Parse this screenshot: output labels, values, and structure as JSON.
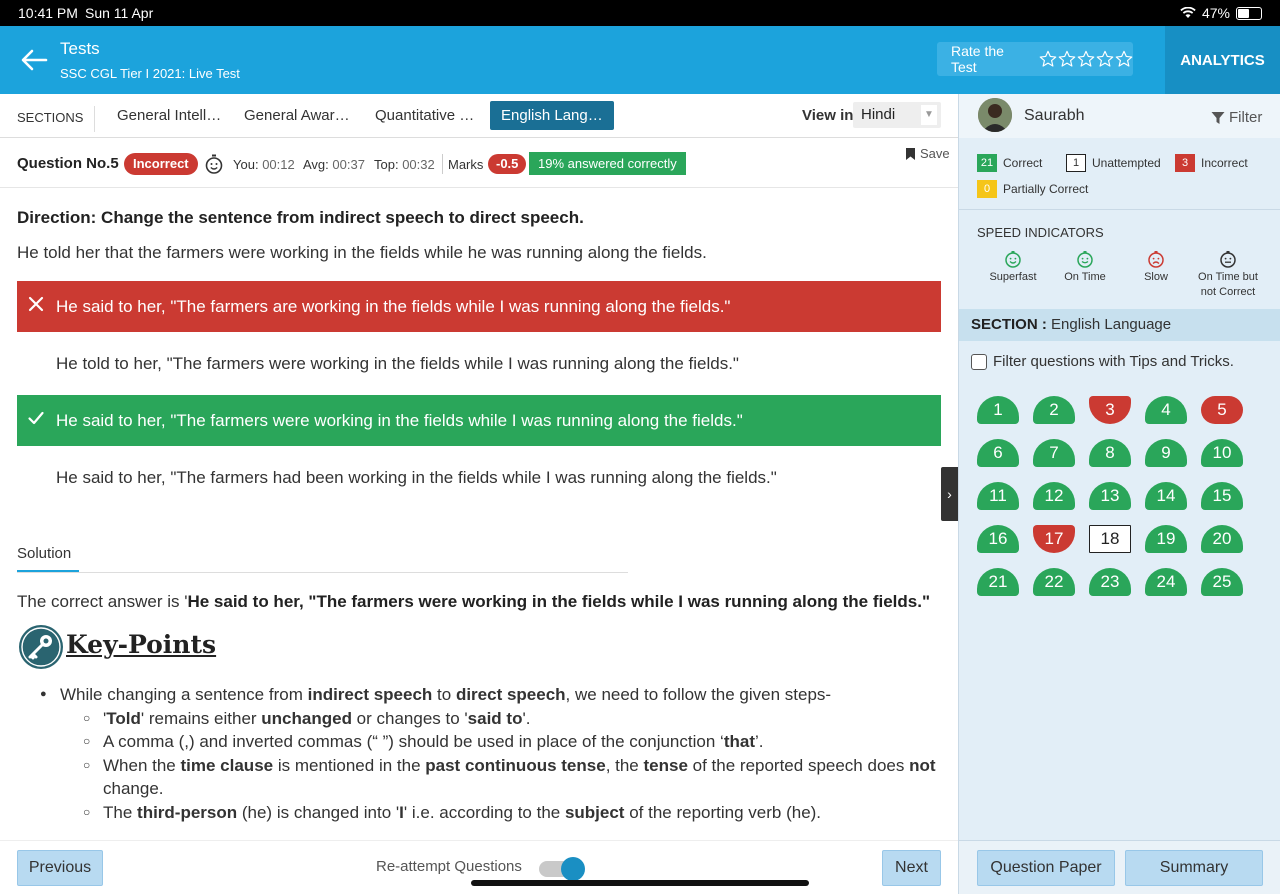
{
  "status": {
    "time": "10:41 PM",
    "date": "Sun 11 Apr",
    "battery": "47%"
  },
  "header": {
    "title": "Tests",
    "subtitle": "SSC CGL Tier I 2021: Live Test",
    "rate_label": "Rate the Test",
    "rating_stars": 0,
    "analytics": "ANALYTICS"
  },
  "sections": {
    "label": "SECTIONS",
    "tabs": [
      "General Intell…",
      "General Awar…",
      "Quantitative …",
      "English Lang…"
    ],
    "active_index": 3,
    "view_in_label": "View in",
    "language": "Hindi"
  },
  "question": {
    "number_label": "Question No.5",
    "status": "Incorrect",
    "you_label": "You:",
    "you": "00:12",
    "avg_label": "Avg:",
    "avg": "00:37",
    "top_label": "Top:",
    "top": "00:32",
    "marks_label": "Marks",
    "marks": "-0.5",
    "answered_correctly": "19% answered correctly",
    "save": "Save",
    "direction": "Direction: Change the sentence from indirect speech to direct speech.",
    "text": "He told her that the farmers were working in the fields while he was running along the fields.",
    "options": [
      {
        "text": "He said to her, \"The farmers are working in the fields while I was running along the fields.\"",
        "state": "wrong"
      },
      {
        "text": "He told to her, \"The farmers were working in the fields while I was running along the fields.\"",
        "state": "none"
      },
      {
        "text": "He said to her, \"The farmers were working in the fields while I was running along the fields.\"",
        "state": "right"
      },
      {
        "text": "He said to her, \"The farmers had been working in the fields while I was running along the fields.\"",
        "state": "none"
      }
    ]
  },
  "solution": {
    "tab": "Solution",
    "correct_prefix": "The correct answer is '",
    "correct_answer": "He said to her, \"The farmers were working in the fields while I was running along the fields.\"",
    "key_points_title": "Key-Points",
    "b1": {
      "t1": "While changing a sentence from ",
      "b1": "indirect speech",
      "t2": " to ",
      "b2": "direct speech",
      "t3": ", we need to follow the given steps-"
    },
    "s1": {
      "t0": "'",
      "b1": "Told",
      "t1": "' remains either ",
      "b2": "unchanged",
      "t2": " or changes to '",
      "b3": "said to",
      "t3": "'."
    },
    "s2": {
      "t1": "A comma (,) and inverted commas (“ ”) should be used in place of the conjunction ‘",
      "b1": "that",
      "t2": "’."
    },
    "s3": {
      "t1": "When the ",
      "b1": "time clause",
      "t2": " is mentioned in the ",
      "b2": "past continuous tense",
      "t3": ", the ",
      "b3": "tense",
      "t4": " of the reported speech does ",
      "b4": "not",
      "t5": " change."
    },
    "s4": {
      "t1": "The ",
      "b1": "third-person",
      "t2": " (he) is changed into '",
      "b2": "I",
      "t3": "' i.e. according to the ",
      "b3": "subject",
      "t4": " of the reporting verb (he)."
    }
  },
  "footer": {
    "previous": "Previous",
    "reattempt": "Re-attempt Questions",
    "reattempt_on": true,
    "next": "Next"
  },
  "panel": {
    "user": "Saurabh",
    "filter": "Filter",
    "legend": {
      "correct_count": "21",
      "correct": "Correct",
      "unattempted_count": "1",
      "unattempted": "Unattempted",
      "incorrect_count": "3",
      "incorrect": "Incorrect",
      "partial_count": "0",
      "partial": "Partially Correct"
    },
    "speed_title": "SPEED INDICATORS",
    "speed": {
      "superfast": "Superfast",
      "ontime": "On Time",
      "slow": "Slow",
      "ontime_wrong_1": "On Time but",
      "ontime_wrong_2": "not Correct"
    },
    "section_label": "SECTION :",
    "section_name": "English Language",
    "tips": "Filter questions with Tips and Tricks.",
    "questions": [
      {
        "n": "1",
        "s": "correct"
      },
      {
        "n": "2",
        "s": "correct"
      },
      {
        "n": "3",
        "s": "incorrect"
      },
      {
        "n": "4",
        "s": "correct"
      },
      {
        "n": "5",
        "s": "incorrect-active"
      },
      {
        "n": "6",
        "s": "correct"
      },
      {
        "n": "7",
        "s": "correct"
      },
      {
        "n": "8",
        "s": "correct"
      },
      {
        "n": "9",
        "s": "correct"
      },
      {
        "n": "10",
        "s": "correct"
      },
      {
        "n": "11",
        "s": "correct"
      },
      {
        "n": "12",
        "s": "correct"
      },
      {
        "n": "13",
        "s": "correct"
      },
      {
        "n": "14",
        "s": "correct"
      },
      {
        "n": "15",
        "s": "correct"
      },
      {
        "n": "16",
        "s": "correct"
      },
      {
        "n": "17",
        "s": "incorrect"
      },
      {
        "n": "18",
        "s": "unattempted"
      },
      {
        "n": "19",
        "s": "correct"
      },
      {
        "n": "20",
        "s": "correct"
      },
      {
        "n": "21",
        "s": "correct"
      },
      {
        "n": "22",
        "s": "correct"
      },
      {
        "n": "23",
        "s": "correct"
      },
      {
        "n": "24",
        "s": "correct"
      },
      {
        "n": "25",
        "s": "correct"
      }
    ],
    "question_paper": "Question Paper",
    "summary": "Summary"
  },
  "colors": {
    "header": "#1ca3dc",
    "correct": "#2aa65a",
    "incorrect": "#cb3a32",
    "partial": "#f5c518"
  }
}
